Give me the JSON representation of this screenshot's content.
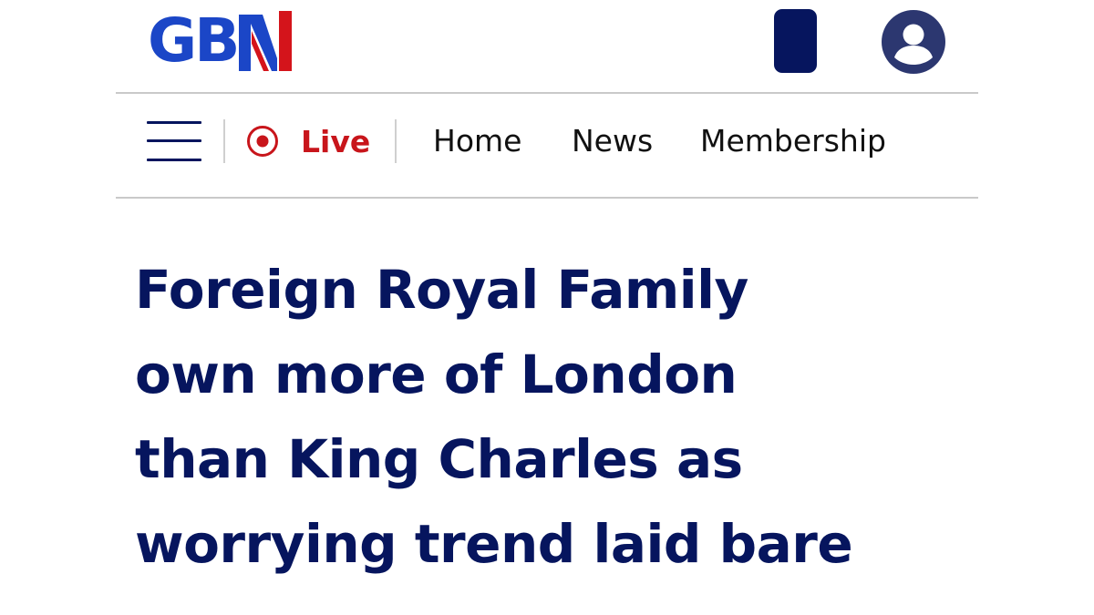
{
  "header": {
    "logo": {
      "text": "GB",
      "mark_letter": "N",
      "colors": {
        "blue": "#1b46c7",
        "red": "#d4141b"
      }
    },
    "device_icon": "mobile-device-icon",
    "account_icon": "user-account-icon"
  },
  "nav": {
    "menu_icon": "hamburger-menu-icon",
    "live": {
      "icon": "live-record-icon",
      "label": "Live",
      "color": "#c8151b"
    },
    "links": [
      {
        "label": "Home"
      },
      {
        "label": "News"
      },
      {
        "label": "Membership"
      }
    ]
  },
  "article": {
    "headline_lines": [
      "Foreign Royal Family",
      "own more of London",
      "than King Charles as",
      "worrying trend laid bare"
    ],
    "headline_color": "#06155e"
  }
}
